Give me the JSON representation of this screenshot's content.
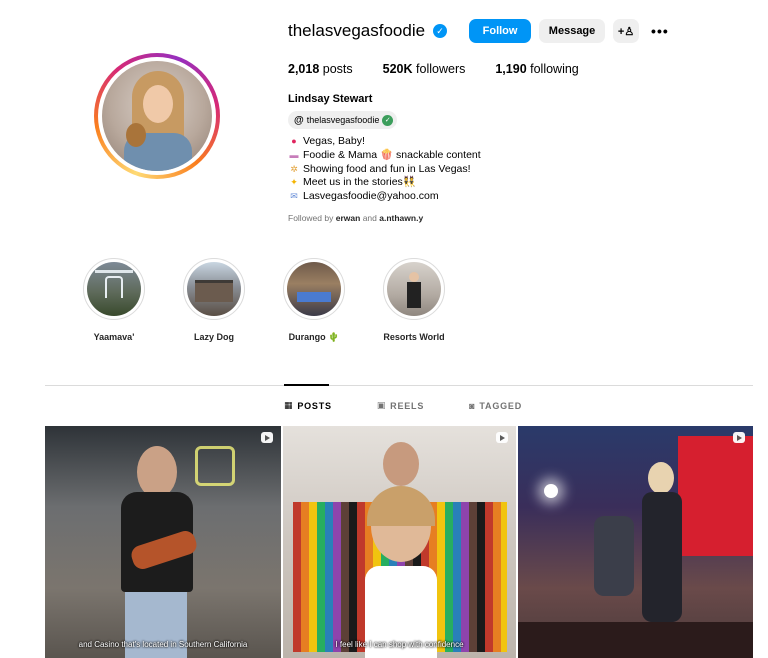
{
  "profile": {
    "username": "thelasvegasfoodie",
    "follow_label": "Follow",
    "message_label": "Message",
    "posts_count": "2,018",
    "posts_label": "posts",
    "followers_count": "520K",
    "followers_label": "followers",
    "following_count": "1,190",
    "following_label": "following",
    "full_name": "Lindsay Stewart",
    "threads_handle": "thelasvegasfoodie",
    "bio": [
      {
        "icon": "balloon-icon",
        "text": "Vegas, Baby!"
      },
      {
        "icon": "cake-icon",
        "text": "Foodie & Mama 🍿 snackable content"
      },
      {
        "icon": "sparkle-icon",
        "text": "Showing food and fun in Las Vegas!"
      },
      {
        "icon": "star-icon",
        "text": "Meet us in the stories👯"
      },
      {
        "icon": "mail-icon",
        "text": "Lasvegasfoodie@yahoo.com"
      }
    ],
    "followed_by_prefix": "Followed by",
    "followed_by_user1": "erwan",
    "followed_by_and": "and",
    "followed_by_user2": "a.nthawn.y"
  },
  "highlights": [
    {
      "label": "Yaamava'"
    },
    {
      "label": "Lazy Dog"
    },
    {
      "label": "Durango 🌵"
    },
    {
      "label": "Resorts World"
    }
  ],
  "tabs": [
    {
      "label": "POSTS",
      "icon": "grid-icon",
      "active": true
    },
    {
      "label": "REELS",
      "icon": "reels-icon",
      "active": false
    },
    {
      "label": "TAGGED",
      "icon": "tagged-icon",
      "active": false
    }
  ],
  "posts": [
    {
      "caption": "and Casino that's located in Southern California"
    },
    {
      "caption": "I feel like I can shop with confidence"
    },
    {
      "caption": ""
    }
  ],
  "colors": {
    "accent": "#0095f6",
    "button_gray": "#efefef",
    "muted_text": "#737373"
  }
}
